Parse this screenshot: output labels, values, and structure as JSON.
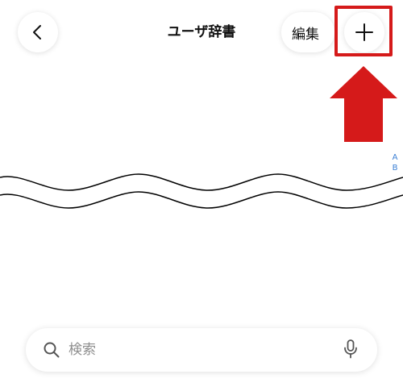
{
  "header": {
    "title": "ユーザ辞書",
    "back_icon": "chevron-left-icon",
    "edit_label": "編集",
    "add_icon": "plus-icon"
  },
  "annotation": {
    "highlight_color": "#d51a1a",
    "arrow_color": "#d51a1a",
    "arrow_direction": "up"
  },
  "index": {
    "letters": [
      "A",
      "B"
    ]
  },
  "search": {
    "placeholder": "検索",
    "search_icon": "magnifier-icon",
    "mic_icon": "microphone-icon"
  }
}
